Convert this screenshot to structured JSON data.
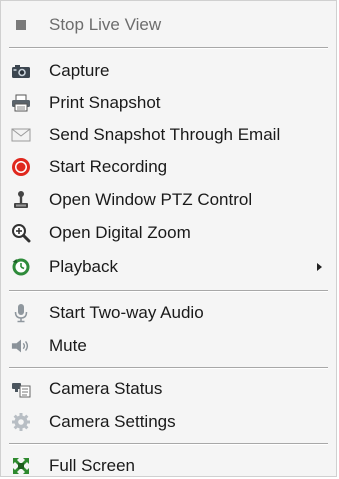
{
  "menu": {
    "items": [
      {
        "label": "Stop Live View",
        "icon": "stop-square-icon",
        "enabled": false
      },
      {
        "label": "Capture",
        "icon": "camera-icon",
        "enabled": true
      },
      {
        "label": "Print Snapshot",
        "icon": "printer-icon",
        "enabled": true
      },
      {
        "label": "Send Snapshot Through Email",
        "icon": "envelope-icon",
        "enabled": true
      },
      {
        "label": "Start Recording",
        "icon": "record-icon",
        "enabled": true
      },
      {
        "label": "Open Window PTZ Control",
        "icon": "ptz-joystick-icon",
        "enabled": true
      },
      {
        "label": "Open Digital Zoom",
        "icon": "zoom-magnifier-icon",
        "enabled": true
      },
      {
        "label": "Playback",
        "icon": "playback-icon",
        "enabled": true,
        "submenu": true
      },
      {
        "label": "Start Two-way Audio",
        "icon": "microphone-icon",
        "enabled": true
      },
      {
        "label": "Mute",
        "icon": "speaker-icon",
        "enabled": true
      },
      {
        "label": "Camera Status",
        "icon": "camera-status-icon",
        "enabled": true
      },
      {
        "label": "Camera Settings",
        "icon": "gear-icon",
        "enabled": true
      },
      {
        "label": "Full Screen",
        "icon": "fullscreen-icon",
        "enabled": true
      }
    ]
  },
  "colors": {
    "menu_background": "#f5f5f5",
    "text": "#1a1a1a",
    "disabled_text": "#6d6d6d",
    "record_red": "#e0281e"
  }
}
